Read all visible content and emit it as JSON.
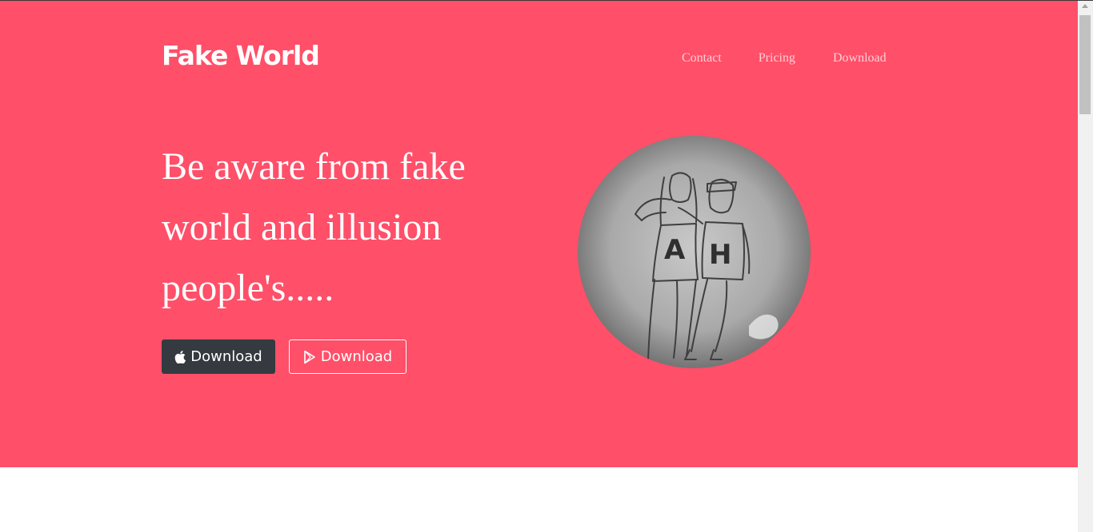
{
  "header": {
    "brand": "Fake World",
    "nav": [
      {
        "label": "Contact"
      },
      {
        "label": "Pricing"
      },
      {
        "label": "Download"
      }
    ]
  },
  "hero": {
    "headline": "Be aware from fake world and illusion people's.....",
    "buttons": {
      "apple": {
        "label": "Download",
        "icon": "apple-icon"
      },
      "play": {
        "label": "Download",
        "icon": "play-store-icon"
      }
    },
    "image": {
      "letters": [
        "A",
        "H"
      ]
    }
  },
  "colors": {
    "hero_background": "#ff4f69",
    "apple_button": "#343a40"
  }
}
